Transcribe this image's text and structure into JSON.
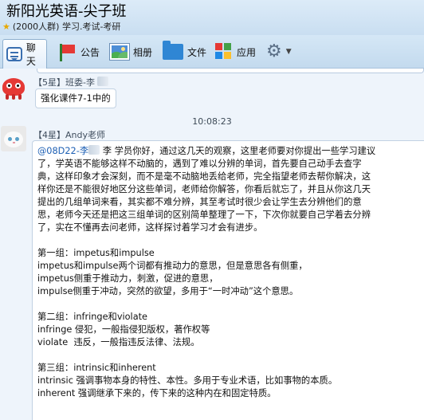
{
  "window": {
    "group_name": "新阳光英语-尖子班",
    "group_meta": "(2000人群) 学习.考试-考研"
  },
  "toolbar": {
    "chat": "聊天",
    "notice": "公告",
    "album": "相册",
    "files": "文件",
    "apps": "应用"
  },
  "messages": [
    {
      "sender": "【5星】班委-李",
      "text": "强化课件7-1中的"
    },
    {
      "timestamp": "10:08:23"
    },
    {
      "sender": "【4星】Andy老师",
      "mention": "@08D22-李",
      "lines": [
        "李 学员你好，通过这几天的观察，这里老师要对你提出一些学习建议",
        "了，学英语不能够这样不动脑的，遇到了难以分辨的单词，首先要自己动手去查字",
        "典，这样印象才会深刻，而不是毫不动脑地丢给老师，完全指望老师去帮你解决，这",
        "样你还是不能很好地区分这些单词，老师给你解答，你看后就忘了，并且从你这几天",
        "提出的几组单词来看，其实都不难分辨，其至考试时很少会让学生去分辨他们的意",
        "思，老师今天还是把这三组单词的区别简单整理了一下，下次你就要自己学着去分辨",
        "了，实在不懂再去问老师，这样探讨着学习才会有进步。",
        "",
        "第一组：impetus和impulse",
        "impetus和impulse两个词都有推动力的意思，但是意思各有侧重，",
        "impetus侧重于推动力，刺激，促进的意思，",
        "impulse侧重于冲动，突然的欲望，多用于“一时冲动”这个意思。",
        "",
        "第二组：infringe和violate",
        "infringe 侵犯，一般指侵犯版权，著作权等",
        "violate  违反，一般指违反法律、法规。",
        "",
        "第三组：intrinsic和inherent",
        "intrinsic 强调事物本身的特性、本性。多用于专业术语，比如事物的本质。",
        "inherent 强调继承下来的，传下来的这种内在和固定特质。"
      ]
    }
  ]
}
